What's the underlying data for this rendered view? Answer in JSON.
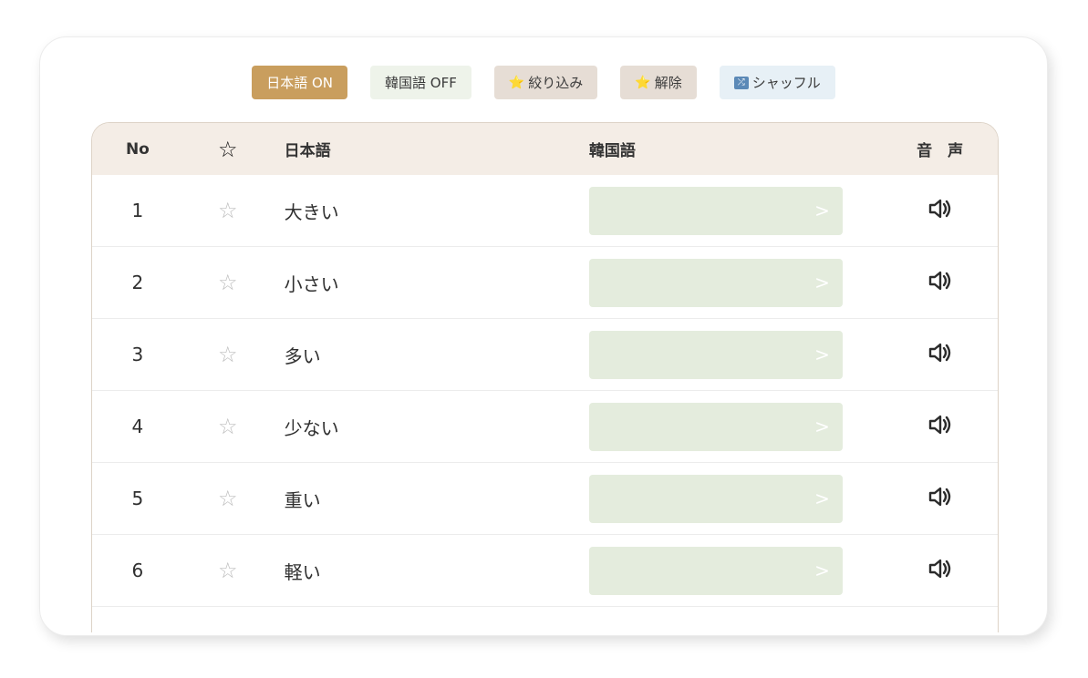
{
  "toolbar": {
    "ja_toggle": "日本語 ON",
    "ko_toggle": "韓国語 OFF",
    "filter": {
      "icon": "star-emoji",
      "label": "絞り込み"
    },
    "clear": {
      "icon": "star-emoji",
      "label": "解除"
    },
    "shuffle": {
      "icon": "shuffle-icon",
      "label": "シャッフル"
    }
  },
  "table": {
    "headers": {
      "no": "No",
      "star": "☆",
      "japanese": "日本語",
      "korean": "韓国語",
      "audio": "音　声"
    },
    "rows": [
      {
        "no": "1",
        "japanese": "大きい",
        "reveal": ">"
      },
      {
        "no": "2",
        "japanese": "小さい",
        "reveal": ">"
      },
      {
        "no": "3",
        "japanese": "多い",
        "reveal": ">"
      },
      {
        "no": "4",
        "japanese": "少ない",
        "reveal": ">"
      },
      {
        "no": "5",
        "japanese": "重い",
        "reveal": ">"
      },
      {
        "no": "6",
        "japanese": "軽い",
        "reveal": ">"
      }
    ]
  },
  "colors": {
    "ja_on": "#c99e5e",
    "ko_off": "#eef3ea",
    "header_bg": "#f4ede6",
    "reveal_bg": "#e4ecdd"
  }
}
